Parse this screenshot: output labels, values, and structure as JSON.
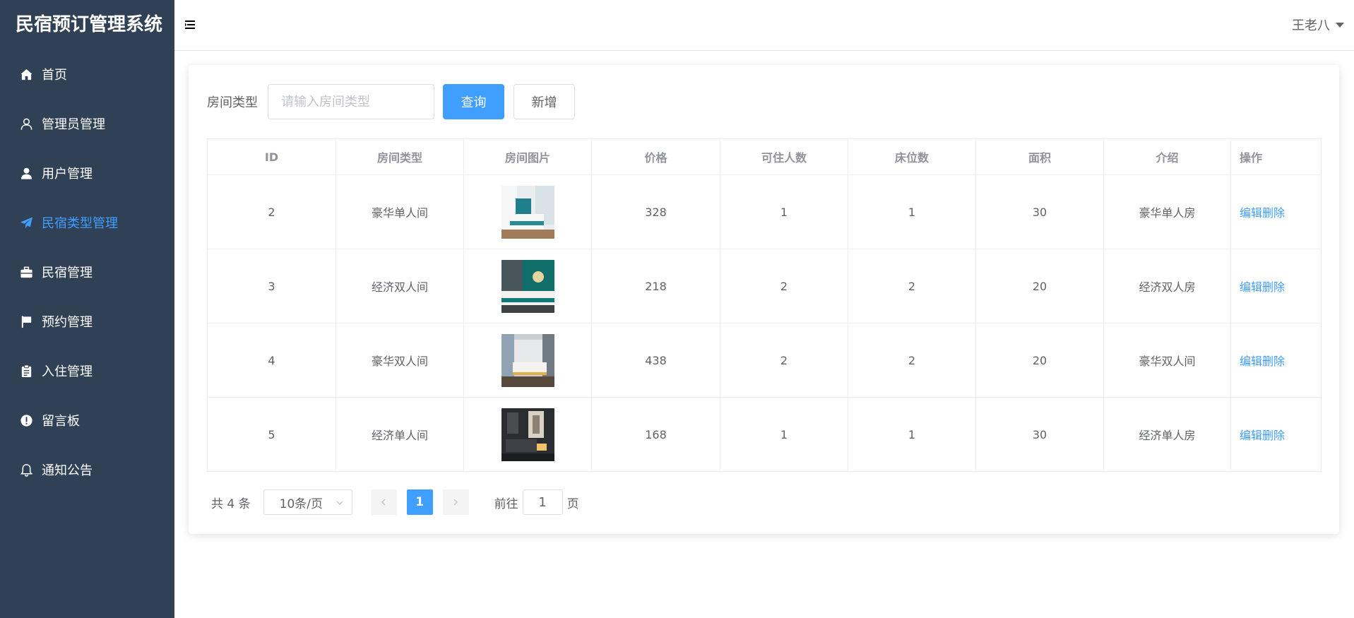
{
  "app": {
    "title": "民宿预订管理系统"
  },
  "sidebar": {
    "items": [
      {
        "label": "首页",
        "icon": "home-icon"
      },
      {
        "label": "管理员管理",
        "icon": "user-outline-icon"
      },
      {
        "label": "用户管理",
        "icon": "user-solid-icon"
      },
      {
        "label": "民宿类型管理",
        "icon": "send-icon",
        "active": true
      },
      {
        "label": "民宿管理",
        "icon": "suitcase-icon"
      },
      {
        "label": "预约管理",
        "icon": "flag-icon"
      },
      {
        "label": "入住管理",
        "icon": "clipboard-icon"
      },
      {
        "label": "留言板",
        "icon": "warning-icon"
      },
      {
        "label": "通知公告",
        "icon": "bell-icon"
      }
    ]
  },
  "header": {
    "user_name": "王老八"
  },
  "search": {
    "label": "房间类型",
    "placeholder": "请输入房间类型",
    "query_label": "查询",
    "add_label": "新增"
  },
  "table": {
    "columns": [
      "ID",
      "房间类型",
      "房间图片",
      "价格",
      "可住人数",
      "床位数",
      "面积",
      "介绍",
      "操作"
    ],
    "rows": [
      {
        "id": "2",
        "type": "豪华单人间",
        "price": "328",
        "capacity": "1",
        "beds": "1",
        "area": "30",
        "intro": "豪华单人房"
      },
      {
        "id": "3",
        "type": "经济双人间",
        "price": "218",
        "capacity": "2",
        "beds": "2",
        "area": "20",
        "intro": "经济双人房"
      },
      {
        "id": "4",
        "type": "豪华双人间",
        "price": "438",
        "capacity": "2",
        "beds": "2",
        "area": "20",
        "intro": "豪华双人间"
      },
      {
        "id": "5",
        "type": "经济单人间",
        "price": "168",
        "capacity": "1",
        "beds": "1",
        "area": "30",
        "intro": "经济单人房"
      }
    ],
    "edit_label": "编辑",
    "delete_label": "删除"
  },
  "pagination": {
    "total": "共 4 条",
    "page_size": "10条/页",
    "current_page": "1",
    "goto_prefix": "前往",
    "goto_value": "1",
    "goto_suffix": "页"
  },
  "colors": {
    "sidebar_bg": "#304156",
    "accent": "#409EFF",
    "text": "#606266"
  }
}
